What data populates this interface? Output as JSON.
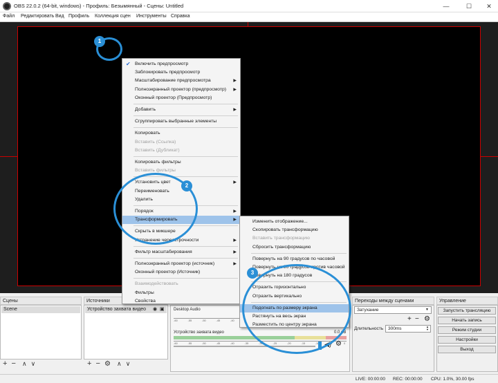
{
  "window": {
    "title": "OBS 22.0.2 (64-bit, windows) - Профиль: Безымянный - Сцены: Untitled",
    "minimize": "—",
    "maximize": "☐",
    "close": "✕"
  },
  "menubar": [
    "Файл",
    "Редактировать",
    "Вид",
    "Профиль",
    "Коллекция сцен",
    "Инструменты",
    "Справка"
  ],
  "context_menu": [
    {
      "label": "Включить предпросмотр",
      "checked": true
    },
    {
      "label": "Заблокировать предпросмотр"
    },
    {
      "label": "Масштабирование предпросмотра",
      "submenu": true
    },
    {
      "label": "Полноэкранный проектор (предпросмотр)",
      "submenu": true
    },
    {
      "label": "Оконный проектор (Предпросмотр)"
    },
    {
      "sep": true
    },
    {
      "label": "Добавить",
      "submenu": true
    },
    {
      "sep": true
    },
    {
      "label": "Сгруппировать выбранные элементы"
    },
    {
      "sep": true
    },
    {
      "label": "Копировать"
    },
    {
      "label": "Вставить (Ссылка)",
      "disabled": true
    },
    {
      "label": "Вставить (Дубликат)",
      "disabled": true
    },
    {
      "sep": true
    },
    {
      "label": "Копировать фильтры"
    },
    {
      "label": "Вставить фильтры",
      "disabled": true
    },
    {
      "sep": true
    },
    {
      "label": "Установить цвет",
      "submenu": true
    },
    {
      "label": "Переименовать"
    },
    {
      "label": "Удалить"
    },
    {
      "sep": true
    },
    {
      "label": "Порядок",
      "submenu": true
    },
    {
      "label": "Трансформировать",
      "submenu": true,
      "highlighted": true
    },
    {
      "sep": true
    },
    {
      "label": "Скрыть в микшере"
    },
    {
      "label": "Устранение чересстрочности",
      "submenu": true
    },
    {
      "sep": true
    },
    {
      "label": "Фильтр масштабирования",
      "submenu": true
    },
    {
      "sep": true
    },
    {
      "label": "Полноэкранный проектор (источник)",
      "submenu": true
    },
    {
      "label": "Оконный проектор (Источник)"
    },
    {
      "sep": true
    },
    {
      "label": "Взаимодействовать",
      "disabled": true
    },
    {
      "label": "Фильтры"
    },
    {
      "label": "Свойства"
    }
  ],
  "transform_submenu": [
    {
      "label": "Изменить отображение..."
    },
    {
      "label": "Скопировать трансформацию"
    },
    {
      "label": "Вставить трансформацию",
      "disabled": true
    },
    {
      "label": "Сбросить трансформацию"
    },
    {
      "sep": true
    },
    {
      "label": "Повернуть на 90 градусов по часовой"
    },
    {
      "label": "Повернуть на 90 градусов против часовой"
    },
    {
      "label": "Повернуть на 180 градусов"
    },
    {
      "sep": true
    },
    {
      "label": "Отразить горизонтально"
    },
    {
      "label": "Отразить вертикально"
    },
    {
      "sep": true
    },
    {
      "label": "Подогнать по размеру экрана",
      "highlighted": true
    },
    {
      "label": "Растянуть на весь экран"
    },
    {
      "label": "Разместить по центру экрана"
    }
  ],
  "callouts": [
    "1",
    "2",
    "3"
  ],
  "docks": {
    "scenes": {
      "title": "Сцены",
      "items": [
        "Scene"
      ]
    },
    "sources": {
      "title": "Источники",
      "items": [
        "Устройство захвата видео"
      ]
    },
    "transitions": {
      "title": "Переходы между сценами",
      "selected": "Затухание",
      "duration_label": "Длительность",
      "duration": "300ms"
    },
    "controls": {
      "title": "Управление",
      "buttons": [
        "Запустить трансляцию",
        "Начать запись",
        "Режим студии",
        "Настройки",
        "Выход"
      ]
    }
  },
  "mixer": {
    "channels": [
      {
        "name": "Desktop Audio",
        "level": "",
        "level_fraction": 0
      },
      {
        "name": "Устройство захвата видео",
        "level": "0.0 dB",
        "level_fraction": 1
      }
    ],
    "scale": [
      "-60",
      "-55",
      "-50",
      "-45",
      "-40",
      "-35",
      "-30",
      "-25",
      "-20",
      "-15",
      "-10",
      "-5",
      "0"
    ]
  },
  "statusbar": {
    "live": "LIVE: 00:00:00",
    "rec": "REC: 00:00:00",
    "cpu": "CPU: 1.0%, 30.00 fps"
  },
  "icons": {
    "plus": "+",
    "minus": "−",
    "gear": "⚙",
    "up": "∧",
    "down": "∨",
    "eye": "👁",
    "lock": "🔒",
    "speaker": "🔊"
  }
}
